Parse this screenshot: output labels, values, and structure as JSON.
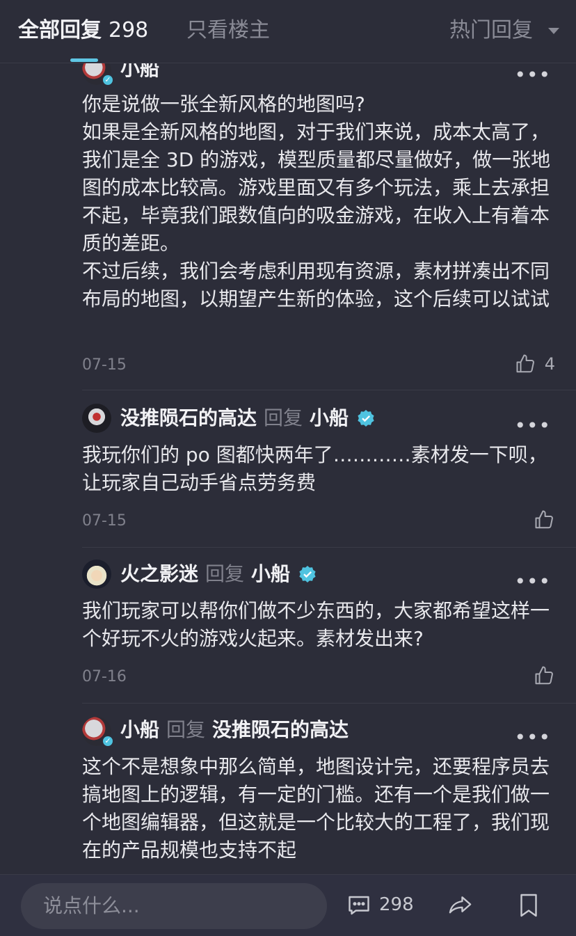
{
  "header": {
    "tab_all": "全部回复",
    "tab_all_count": "298",
    "tab_op_only": "只看楼主",
    "sort_label": "热门回复"
  },
  "replies": [
    {
      "author": "小船",
      "text": "你是说做一张全新风格的地图吗?\n如果是全新风格的地图，对于我们来说，成本太高了，我们是全 3D 的游戏，模型质量都尽量做好，做一张地图的成本比较高。游戏里面又有多个玩法，乘上去承担不起，毕竟我们跟数值向的吸金游戏，在收入上有着本质的差距。\n不过后续，我们会考虑利用现有资源，素材拼凑出不同布局的地图，以期望产生新的体验，这个后续可以试试",
      "date": "07-15",
      "likes": "4"
    },
    {
      "author": "没推陨石的高达",
      "reply_word": "回复",
      "target": "小船",
      "text": "我玩你们的 po 图都快两年了…………素材发一下呗，让玩家自己动手省点劳务费",
      "date": "07-15"
    },
    {
      "author": "火之影迷",
      "reply_word": "回复",
      "target": "小船",
      "text": "我们玩家可以帮你们做不少东西的，大家都希望这样一个好玩不火的游戏火起来。素材发出来?",
      "date": "07-16"
    },
    {
      "author": "小船",
      "reply_word": "回复",
      "target": "没推陨石的高达",
      "text": "这个不是想象中那么简单，地图设计完，还要程序员去搞地图上的逻辑，有一定的门槛。还有一个是我们做一个地图编辑器，但这就是一个比较大的工程了，我们现在的产品规模也支持不起"
    }
  ],
  "bottom_bar": {
    "input_placeholder": "说点什么...",
    "comment_count": "298",
    "icons": [
      "comment-icon",
      "share-icon",
      "bookmark-icon"
    ]
  },
  "colors": {
    "background": "#2c2d39",
    "accent": "#5fc6e4",
    "muted_text": "#80818c"
  }
}
